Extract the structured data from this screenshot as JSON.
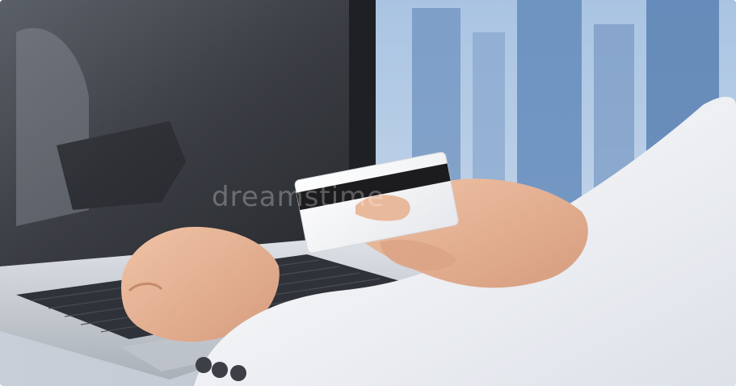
{
  "photo": {
    "subject": "hand-holding-credit-card-at-laptop",
    "watermark_text": "dreamstime",
    "colors": {
      "sky_blue": "#8fb2d6",
      "building_blue": "#5b84b8",
      "screen_dark": "#2b2e33",
      "laptop_silver": "#c9cdd3",
      "keys_dark": "#3a3e45",
      "skin": "#e7b597",
      "shirt_white": "#eef0f4",
      "card_white": "#f4f4f6",
      "stripe_black": "#1c1c1e"
    }
  }
}
